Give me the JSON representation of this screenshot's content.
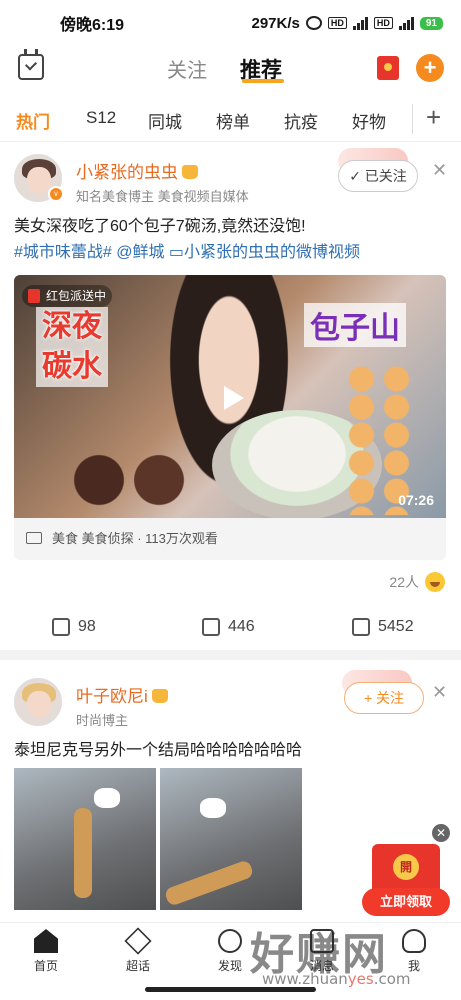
{
  "status_bar": {
    "time": "傍晚6:19",
    "speed": "297K/s",
    "battery": "91"
  },
  "header": {
    "tab_follow": "关注",
    "tab_recommend": "推荐"
  },
  "categories": [
    "热门",
    "S12",
    "同城",
    "榜单",
    "抗疫",
    "好物"
  ],
  "post1": {
    "username": "小紧张的虫虫",
    "subtitle": "知名美食博主 美食视频自媒体",
    "follow_label": "✓ 已关注",
    "text": "美女深夜吃了60个包子7碗汤,竟然还没饱!",
    "topic_line": "#城市味蕾战# @鲜城 ▭小紧张的虫虫的微博视频",
    "video": {
      "redpack_tag": "红包派送中",
      "overlay_left": [
        "深夜",
        "碳水"
      ],
      "overlay_right": "包子山",
      "duration": "07:26"
    },
    "video_meta": "美食 美食侦探 · 113万次观看",
    "likes_count": "22人",
    "actions": {
      "repost": "98",
      "comment": "446",
      "like": "5452"
    }
  },
  "post2": {
    "username": "叶子欧尼i",
    "subtitle": "时尚博主",
    "follow_label": "+ 关注",
    "text": "泰坦尼克号另外一个结局哈哈哈哈哈哈哈"
  },
  "float_redpack": {
    "open": "開",
    "claim": "立即领取",
    "close": "✕"
  },
  "bottom_nav": [
    "首页",
    "超话",
    "发现",
    "消息",
    "我"
  ],
  "watermark": {
    "main": "好赚网",
    "sub_pre": "www.zhuan",
    "sub_y": "yes",
    "sub_post": ".com"
  },
  "colors": {
    "accent": "#f58a1f",
    "link": "#2f6fb3",
    "red": "#e8352b"
  }
}
